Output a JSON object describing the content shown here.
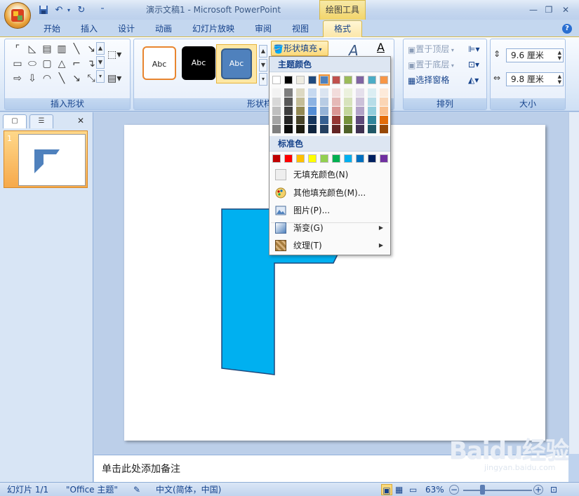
{
  "app": {
    "title": "演示文稿1 - Microsoft PowerPoint",
    "context_tool_title": "绘图工具"
  },
  "tabs": [
    "开始",
    "插入",
    "设计",
    "动画",
    "幻灯片放映",
    "审阅",
    "视图",
    "格式"
  ],
  "ribbon": {
    "insert_shapes_label": "插入形状",
    "shape_styles_label": "形状样式",
    "arrange_label": "排列",
    "size_label": "大小",
    "style_sample_text": "Abc",
    "shape_fill_label": "形状填充",
    "bring_front": "置于顶层",
    "send_back": "置于底层",
    "selection_pane": "选择窗格",
    "height_value": "9.6 厘米",
    "width_value": "9.8 厘米"
  },
  "fill_menu": {
    "theme_colors_header": "主题颜色",
    "standard_colors_header": "标准色",
    "no_fill": "无填充颜色(N)",
    "more_colors": "其他填充颜色(M)...",
    "picture": "图片(P)...",
    "gradient": "渐变(G)",
    "texture": "纹理(T)",
    "theme_colors": [
      "#ffffff",
      "#000000",
      "#eeece1",
      "#1f497d",
      "#4f81bd",
      "#c0504d",
      "#9bbb59",
      "#8064a2",
      "#4bacc6",
      "#f79646"
    ],
    "theme_shades": [
      [
        "#f2f2f2",
        "#7f7f7f",
        "#ddd9c3",
        "#c6d9f0",
        "#dbe5f1",
        "#f2dcdb",
        "#ebf1dd",
        "#e5e0ec",
        "#dbeef3",
        "#fdeada"
      ],
      [
        "#d8d8d8",
        "#595959",
        "#c4bd97",
        "#8db3e2",
        "#b8cce4",
        "#e5b9b7",
        "#d7e3bc",
        "#ccc1d9",
        "#b7dde8",
        "#fbd5b5"
      ],
      [
        "#bfbfbf",
        "#3f3f3f",
        "#938953",
        "#548dd4",
        "#95b3d7",
        "#d99694",
        "#c3d69b",
        "#b2a2c7",
        "#92cddc",
        "#fac08f"
      ],
      [
        "#a5a5a5",
        "#262626",
        "#494429",
        "#17365d",
        "#366092",
        "#953734",
        "#76923c",
        "#5f497a",
        "#31859b",
        "#e36c09"
      ],
      [
        "#7f7f7f",
        "#0c0c0c",
        "#1d1b10",
        "#0f243e",
        "#244061",
        "#632423",
        "#4f6128",
        "#3f3151",
        "#205867",
        "#974806"
      ]
    ],
    "standard_colors": [
      "#c00000",
      "#ff0000",
      "#ffc000",
      "#ffff00",
      "#92d050",
      "#00b050",
      "#00b0f0",
      "#0070c0",
      "#002060",
      "#7030a0"
    ]
  },
  "panel": {
    "slide_number": "1"
  },
  "slide": {
    "shape_fill": "#00b0f0",
    "shape_stroke": "#1f497d",
    "thumb_fill": "#4f81bd"
  },
  "notes_placeholder": "单击此处添加备注",
  "status": {
    "slide_count": "幻灯片 1/1",
    "theme": "\"Office 主题\"",
    "language": "中文(简体，中国)",
    "zoom": "63%"
  },
  "watermark": {
    "brand": "Baidu经验",
    "site": "jingyan.baidu.com"
  }
}
